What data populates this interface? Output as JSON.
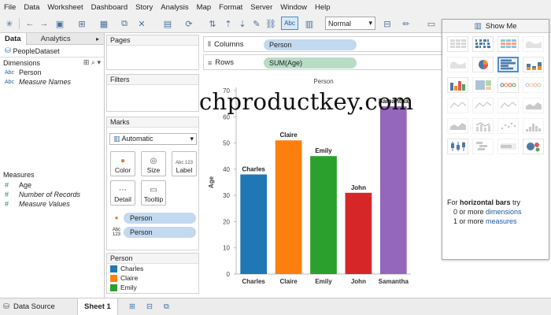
{
  "menu": [
    "File",
    "Data",
    "Worksheet",
    "Dashboard",
    "Story",
    "Analysis",
    "Map",
    "Format",
    "Server",
    "Window",
    "Help"
  ],
  "toolbar": {
    "abc_label": "Abc",
    "fit_select": "Normal"
  },
  "datapane": {
    "tab_data": "Data",
    "tab_analytics": "Analytics",
    "datasource": "PeopleDataset",
    "dimensions_header": "Dimensions",
    "dimensions": [
      {
        "icon": "Abc",
        "label": "Person",
        "italic": false
      },
      {
        "icon": "Abc",
        "label": "Measure Names",
        "italic": true
      }
    ],
    "measures_header": "Measures",
    "measures": [
      {
        "icon": "#",
        "label": "Age",
        "italic": false
      },
      {
        "icon": "#",
        "label": "Number of Records",
        "italic": true
      },
      {
        "icon": "#",
        "label": "Measure Values",
        "italic": true
      }
    ]
  },
  "cards": {
    "pages": "Pages",
    "filters": "Filters",
    "marks": "Marks",
    "marks_type": "Automatic",
    "mark_buttons": {
      "color": "Color",
      "size": "Size",
      "label": "Label",
      "detail": "Detail",
      "tooltip": "Tooltip"
    },
    "label_icon_text": "Abc 123",
    "mark_pills": [
      "Person",
      "Person"
    ],
    "legend_title": "Person",
    "legend": [
      {
        "label": "Charles",
        "color": "#1f77b4"
      },
      {
        "label": "Claire",
        "color": "#ff7f0e"
      },
      {
        "label": "Emily",
        "color": "#2ca02c"
      }
    ]
  },
  "shelves": {
    "columns_label": "Columns",
    "columns_pill": "Person",
    "rows_label": "Rows",
    "rows_pill": "SUM(Age)"
  },
  "chart_data": {
    "type": "bar",
    "title": "Person",
    "ylabel": "Age",
    "xlabel": "",
    "categories": [
      "Charles",
      "Claire",
      "Emily",
      "John",
      "Samantha"
    ],
    "values": [
      38,
      51,
      45,
      31,
      64
    ],
    "colors": [
      "#1f77b4",
      "#ff7f0e",
      "#2ca02c",
      "#d62728",
      "#9467bd"
    ],
    "ylim": [
      0,
      70
    ],
    "yticks": [
      0,
      10,
      20,
      30,
      40,
      50,
      60,
      70
    ],
    "grid": false,
    "data_labels": true
  },
  "showme": {
    "title": "Show Me",
    "hint_prefix": "For",
    "hint_bold": "horizontal bars",
    "hint_suffix": "try",
    "hint_line2_a": "0 or more",
    "hint_line2_b": "dimensions",
    "hint_line3_a": "1 or more",
    "hint_line3_b": "measures"
  },
  "bottom": {
    "datasource_tab": "Data Source",
    "sheet_tab": "Sheet 1"
  },
  "watermark": "chproductkey.com"
}
